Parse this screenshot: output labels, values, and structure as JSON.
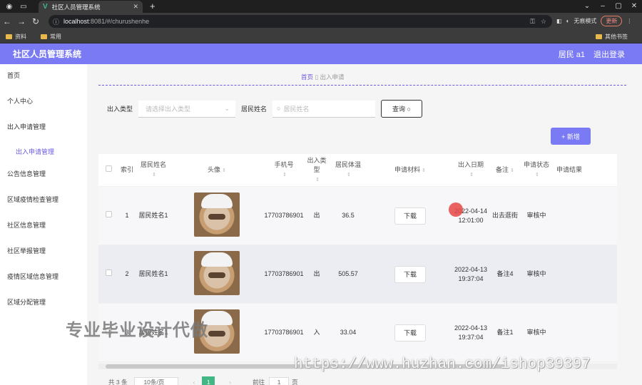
{
  "browser": {
    "tab_title": "社区人员管理系统",
    "url_host": "localhost",
    "url_rest": ":8081/#/churushenhe",
    "incognito_label": "无痕模式",
    "update_label": "更新",
    "bookmarks": [
      "资料",
      "常用"
    ],
    "bookmarks_right": "其他书签"
  },
  "app": {
    "title": "社区人员管理系统",
    "user": "居民 a1",
    "logout": "退出登录"
  },
  "sidebar": {
    "items": [
      "首页",
      "个人中心",
      "出入申请管理",
      "出入申请管理",
      "公告信息管理",
      "区域疫情检查管理",
      "社区信息管理",
      "社区举报管理",
      "疫情区域信息管理",
      "区域分配管理"
    ]
  },
  "breadcrumb": {
    "home": "首页",
    "current": "出入申请"
  },
  "filter": {
    "type_label": "出入类型",
    "type_placeholder": "请选择出入类型",
    "name_label": "居民姓名",
    "name_placeholder": "居民姓名",
    "query_button": "查询"
  },
  "add_button": "+ 新增",
  "table": {
    "headers": [
      "索引",
      "居民姓名",
      "头像",
      "手机号",
      "出入类型",
      "居民体温",
      "申请材料",
      "出入日期",
      "备注",
      "申请状态",
      "申请结果"
    ],
    "rows": [
      {
        "idx": "1",
        "name": "居民姓名1",
        "phone": "17703786901",
        "type": "出",
        "temp": "36.5",
        "download": "下载",
        "date": "2022-04-14 12:01:00",
        "note": "出去逛街",
        "status": "审核中",
        "result": ""
      },
      {
        "idx": "2",
        "name": "居民姓名1",
        "phone": "17703786901",
        "type": "出",
        "temp": "505.57",
        "download": "下载",
        "date": "2022-04-13 19:37:04",
        "note": "备注4",
        "status": "审核中",
        "result": ""
      },
      {
        "idx": "3",
        "name": "居民姓名1",
        "phone": "17703786901",
        "type": "入",
        "temp": "33.04",
        "download": "下载",
        "date": "2022-04-13 19:37:04",
        "note": "备注1",
        "status": "审核中",
        "result": ""
      }
    ]
  },
  "pager": {
    "total": "共 3 条",
    "page_size": "10条/页",
    "current_page": "1",
    "goto_label": "前往",
    "goto_value": "1",
    "page_suffix": "页"
  },
  "watermarks": {
    "text1": "专业毕业设计代做",
    "text2": "https://www.huzhan.com/ishop39397"
  }
}
